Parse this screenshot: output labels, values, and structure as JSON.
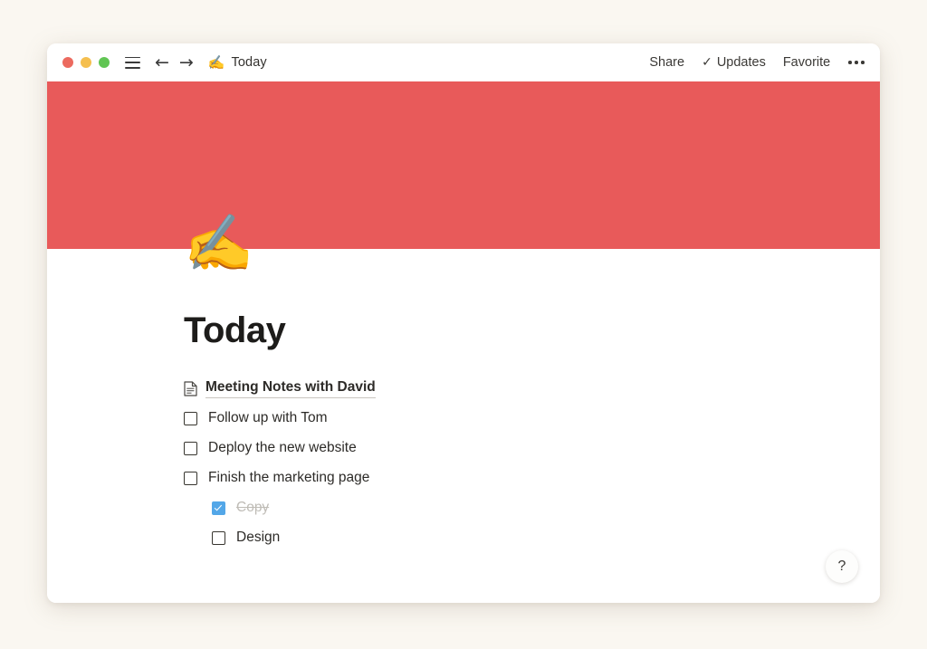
{
  "window": {
    "traffic_lights": [
      {
        "name": "close",
        "color": "#EC6A5F"
      },
      {
        "name": "minimize",
        "color": "#F5BF4F"
      },
      {
        "name": "maximize",
        "color": "#61C554"
      }
    ],
    "nav": {
      "back_icon": "←",
      "forward_icon": "→"
    },
    "breadcrumb": {
      "emoji": "✍️",
      "title": "Today"
    },
    "actions": {
      "share": "Share",
      "updates": "Updates",
      "updates_check_glyph": "✓",
      "favorite": "Favorite",
      "more_label": "•••"
    }
  },
  "cover": {
    "color": "#E85A5A"
  },
  "page": {
    "icon_emoji": "✍️",
    "title": "Today",
    "blocks": [
      {
        "type": "page_link",
        "icon": "document-icon",
        "text": "Meeting Notes with David",
        "indent": 0
      },
      {
        "type": "todo",
        "text": "Follow up with Tom",
        "checked": false,
        "indent": 0
      },
      {
        "type": "todo",
        "text": "Deploy the new website",
        "checked": false,
        "indent": 0
      },
      {
        "type": "todo",
        "text": "Finish the marketing page",
        "checked": false,
        "indent": 0
      },
      {
        "type": "todo",
        "text": "Copy",
        "checked": true,
        "indent": 1
      },
      {
        "type": "todo",
        "text": "Design",
        "checked": false,
        "indent": 1
      }
    ]
  },
  "help": {
    "label": "?"
  },
  "colors": {
    "desktop_background": "#FAF7F1",
    "cover_red": "#E85A5A",
    "checkbox_blue": "#53A7E8",
    "text_primary": "#2d2b28",
    "text_muted": "#bfbcb6"
  }
}
